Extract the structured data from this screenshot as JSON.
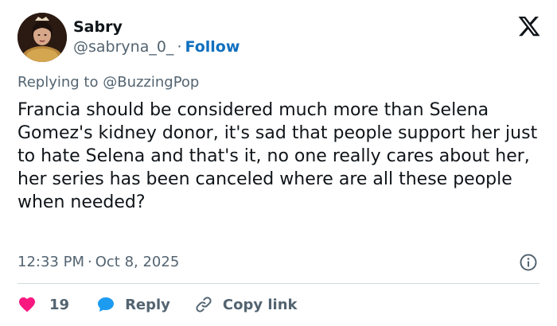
{
  "user": {
    "display_name": "Sabry",
    "handle": "@sabryna_0_",
    "separator": "·",
    "follow_label": "Follow"
  },
  "reply_context": {
    "prefix": "Replying to",
    "mention": "@BuzzingPop"
  },
  "tweet": {
    "text": "Francia should be considered much more than Selena Gomez's kidney donor, it's sad that people support her just to hate Selena and that's it, no one really cares about her, her series has been canceled where are all these people when needed?",
    "time": "12:33 PM",
    "date_separator": "·",
    "date": "Oct 8, 2025"
  },
  "actions": {
    "like_count": "19",
    "reply_label": "Reply",
    "copy_link_label": "Copy link"
  },
  "icons": {
    "brand": "x-logo-icon",
    "info": "info-icon",
    "like": "heart-icon",
    "reply": "comment-bubble-icon",
    "copy": "link-icon"
  },
  "colors": {
    "text_primary": "#0f1419",
    "text_secondary": "#536471",
    "follow_blue": "#0f6fbf",
    "like_pink": "#f91880",
    "reply_blue": "#1d9bf0",
    "divider": "#cfd9de"
  }
}
